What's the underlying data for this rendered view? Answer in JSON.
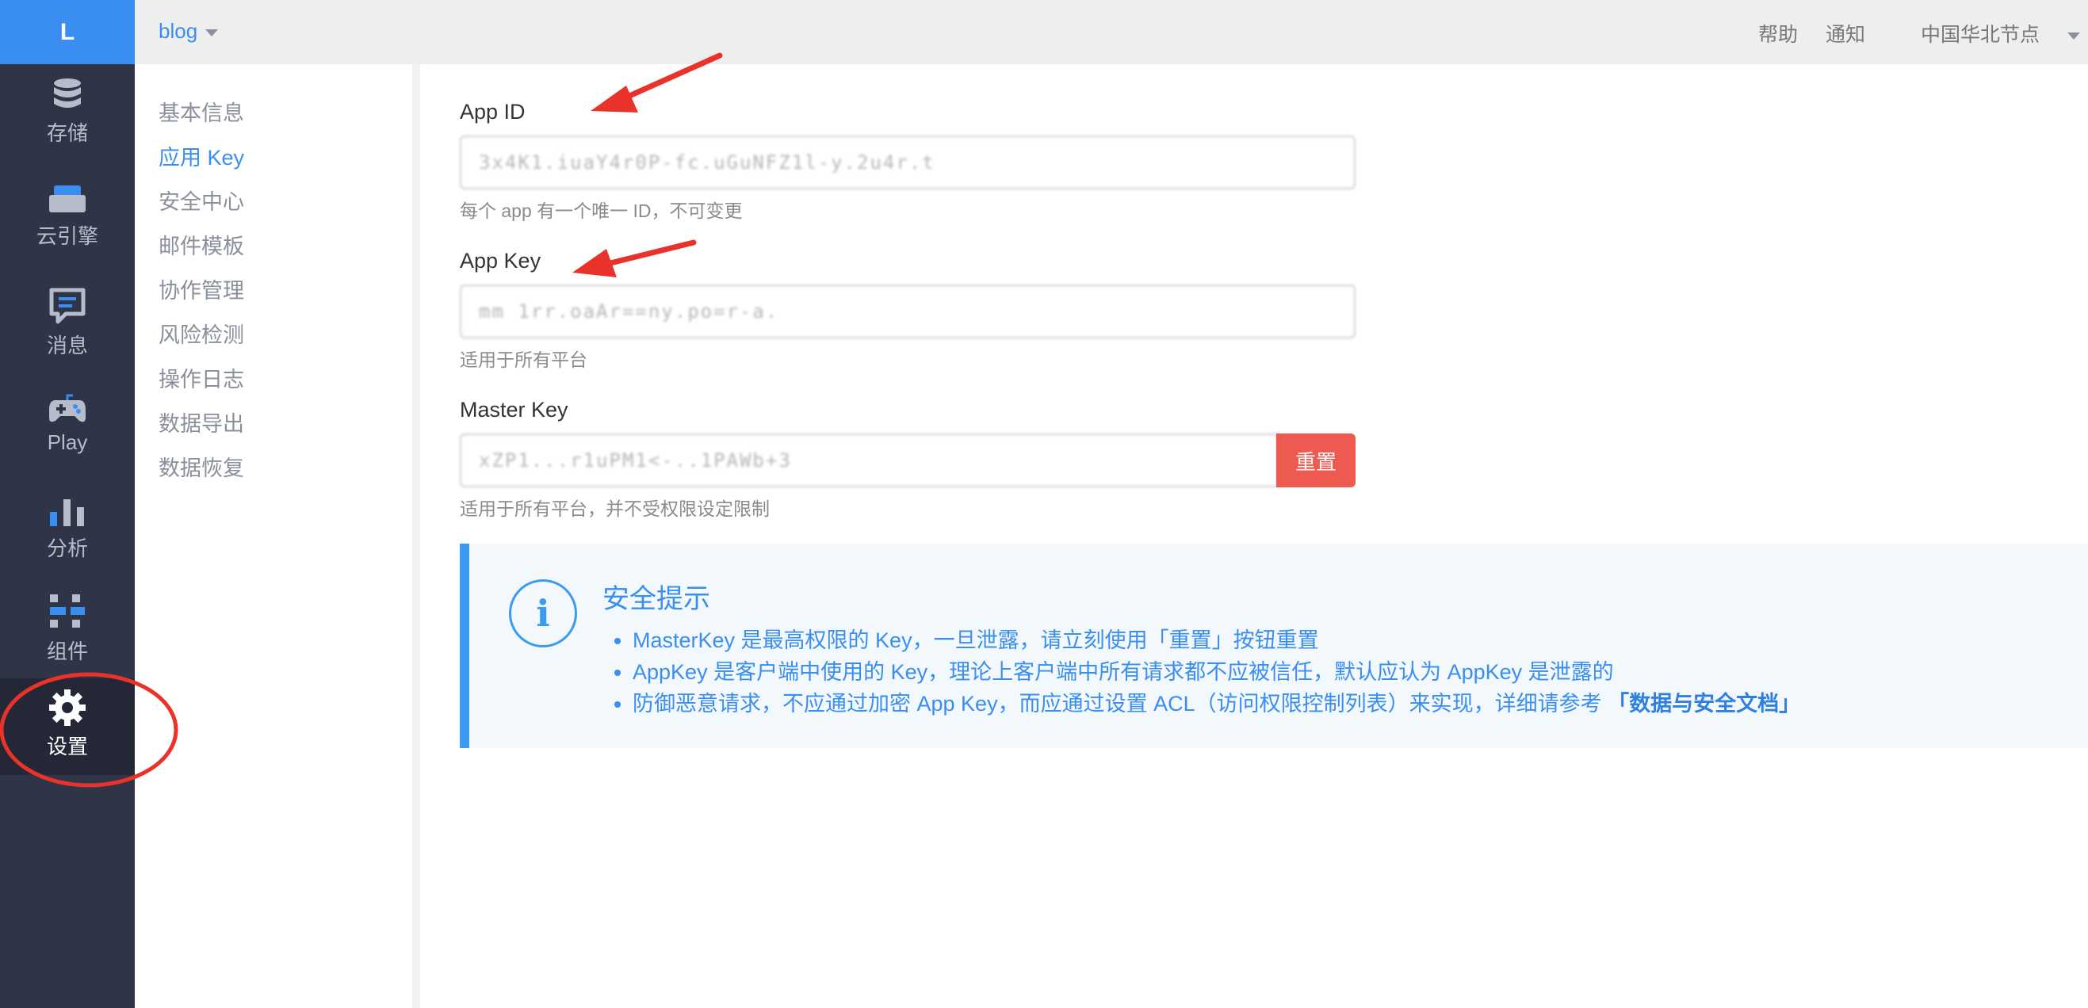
{
  "rail": {
    "logo": "L",
    "items": [
      {
        "label": "存储",
        "icon": "database-icon"
      },
      {
        "label": "云引擎",
        "icon": "server-icon"
      },
      {
        "label": "消息",
        "icon": "message-icon"
      },
      {
        "label": "Play",
        "icon": "gamepad-icon"
      },
      {
        "label": "分析",
        "icon": "bar-chart-icon"
      },
      {
        "label": "组件",
        "icon": "components-icon"
      },
      {
        "label": "设置",
        "icon": "gear-icon"
      }
    ]
  },
  "topbar": {
    "app_name": "blog",
    "help": "帮助",
    "notifications": "通知",
    "region": "中国华北节点"
  },
  "subnav": {
    "items": [
      "基本信息",
      "应用 Key",
      "安全中心",
      "邮件模板",
      "协作管理",
      "风险检测",
      "操作日志",
      "数据导出",
      "数据恢复"
    ],
    "active": "应用 Key"
  },
  "main": {
    "app_id": {
      "label": "App ID",
      "value": "3x4K1.iuaY4r0P-fc.uGuNFZ1l-y.2u4r.t",
      "help": "每个 app 有一个唯一 ID，不可变更"
    },
    "app_key": {
      "label": "App Key",
      "value": "mm  1rr.oaAr==ny.po=r-a.",
      "help": "适用于所有平台"
    },
    "master_key": {
      "label": "Master Key",
      "value": "xZP1...r1uPM1<-..1PAWb+3",
      "help": "适用于所有平台，并不受权限设定限制",
      "reset_label": "重置"
    },
    "security_tip": {
      "title": "安全提示",
      "items": [
        "MasterKey 是最高权限的 Key，一旦泄露，请立刻使用「重置」按钮重置",
        "AppKey 是客户端中使用的 Key，理论上客户端中所有请求都不应被信任，默认应认为 AppKey 是泄露的",
        "防御恶意请求，不应通过加密 App Key，而应通过设置 ACL（访问权限控制列表）来实现，详细请参考"
      ],
      "link": "「数据与安全文档」"
    }
  },
  "colors": {
    "accent": "#3a8ef0",
    "rail_bg": "#2f3447",
    "danger": "#ef5a50",
    "annotation": "#e8322a"
  }
}
